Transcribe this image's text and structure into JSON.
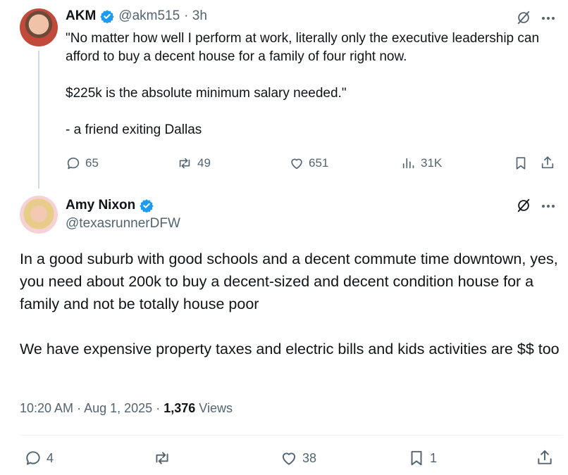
{
  "tweet1": {
    "name": "AKM",
    "handle": "@akm515",
    "time": "· 3h",
    "text": "\"No matter how well I perform at work, literally only the executive leadership can afford to buy a decent house for a family of four right now.\n\n$225k is the absolute minimum salary needed.\"\n\n- a friend exiting Dallas",
    "replies": "65",
    "reposts": "49",
    "likes": "651",
    "views": "31K"
  },
  "tweet2": {
    "name": "Amy Nixon",
    "handle": "@texasrunnerDFW",
    "text": "In a good suburb with good schools and a decent commute time downtown, yes, you need about 200k to buy a decent-sized and decent condition house for a family and not be totally house poor\n\nWe have expensive property taxes and electric bills and kids activities are $$ too",
    "time": "10:20 AM",
    "date": "Aug 1, 2025",
    "views_count": "1,376",
    "views_label": "Views",
    "replies": "4",
    "likes": "38",
    "bookmarks": "1"
  },
  "colors": {
    "verified": "#1d9bf0",
    "muted": "#536471",
    "text": "#0f1419"
  }
}
